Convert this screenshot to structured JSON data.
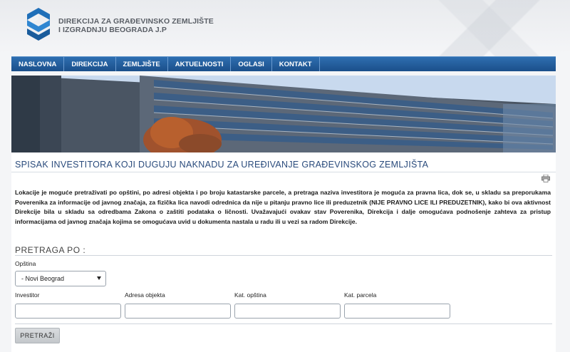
{
  "header": {
    "brand_line1": "DIREKCIJA ZA GRAĐEVINSKO ZEMLJIŠTE",
    "brand_line2": "I IZGRADNJU BEOGRADA J.P",
    "logo_icon": "direkcija-logo-icon"
  },
  "nav": {
    "items": [
      {
        "label": "NASLOVNA"
      },
      {
        "label": "DIREKCIJA"
      },
      {
        "label": "ZEMLJIŠTE"
      },
      {
        "label": "AKTUELNOSTI"
      },
      {
        "label": "OGLASI"
      },
      {
        "label": "KONTAKT"
      }
    ]
  },
  "main": {
    "title": "SPISAK INVESTITORA KOJI DUGUJU NAKNADU ZA UREĐIVANJE GRAĐEVINSKOG ZEMLJIŠTA",
    "print_icon": "printer-icon",
    "description": "Lokacije je moguće pretraživati po opštini, po adresi objekta i po broju katastarske parcele,  a pretraga naziva investitora je moguća za pravna lica, dok se, u skladu sa preporukama Poverenika za informacije od javnog značaja, za fizička lica navodi odrednica da nije u pitanju pravno lice ili preduzetnik (NIJE PRAVNO LICE ILI PREDUZETNIK), kako bi ova aktivnost Direkcije bila u skladu sa odredbama Zakona o zaštiti podataka o ličnosti. Uvažavajući ovakav stav Poverenika, Direkcija i dalje omogućava podnošenje zahteva za pristup informacijama od javnog značaja kojima se omogućava uvid u dokumenta nastala u radu ili u vezi sa radom Direkcije."
  },
  "search": {
    "heading": "PRETRAGA PO :",
    "opstina_label": "Opština",
    "opstina_value": "- Novi Beograd",
    "fields": [
      {
        "label": "Investitor",
        "value": "",
        "placeholder": ""
      },
      {
        "label": "Adresa objekta",
        "value": "",
        "placeholder": ""
      },
      {
        "label": "Kat. opština",
        "value": "",
        "placeholder": ""
      },
      {
        "label": "Kat. parcela",
        "value": "",
        "placeholder": ""
      }
    ],
    "button_label": "PRETRAŽI"
  },
  "colors": {
    "nav_bg": "#1b4f8a",
    "title": "#2a4b7c",
    "logo": "#1f6fb8"
  }
}
